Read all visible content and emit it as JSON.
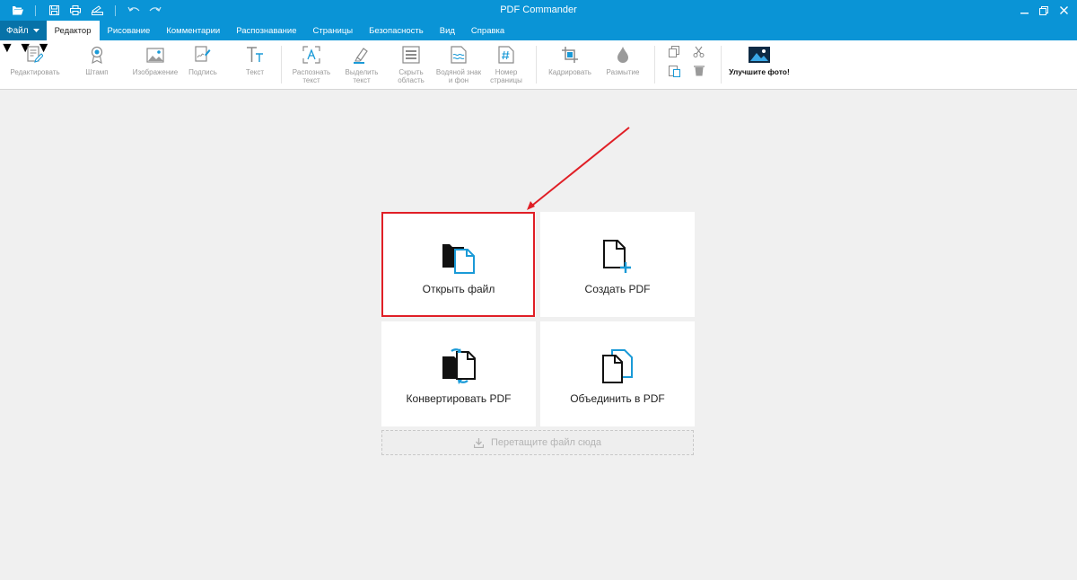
{
  "window": {
    "title": "PDF Commander"
  },
  "menu": {
    "file_label": "Файл",
    "tabs": [
      {
        "label": "Редактор",
        "active": true
      },
      {
        "label": "Рисование"
      },
      {
        "label": "Комментарии"
      },
      {
        "label": "Распознавание"
      },
      {
        "label": "Страницы"
      },
      {
        "label": "Безопасность"
      },
      {
        "label": "Вид"
      },
      {
        "label": "Справка"
      }
    ]
  },
  "toolbar": {
    "edit": "Редактировать",
    "stamp": "Штамп",
    "image": "Изображение",
    "signature": "Подпись",
    "text": "Текст",
    "recognize_1": "Распознать",
    "recognize_2": "текст",
    "highlight_1": "Выделить",
    "highlight_2": "текст",
    "hide_1": "Скрыть",
    "hide_2": "область",
    "watermark_1": "Водяной знак",
    "watermark_2": "и фон",
    "pagenum_1": "Номер",
    "pagenum_2": "страницы",
    "crop": "Кадрировать",
    "blur": "Размытие",
    "promo": "Улучшите фото!"
  },
  "start": {
    "open": "Открыть файл",
    "create": "Создать PDF",
    "convert": "Конвертировать PDF",
    "merge": "Объединить в PDF",
    "drop": "Перетащите файл сюда"
  },
  "colors": {
    "accent": "#0a94d6",
    "highlight": "#e01f26",
    "icon_blue": "#1a9ad7"
  }
}
